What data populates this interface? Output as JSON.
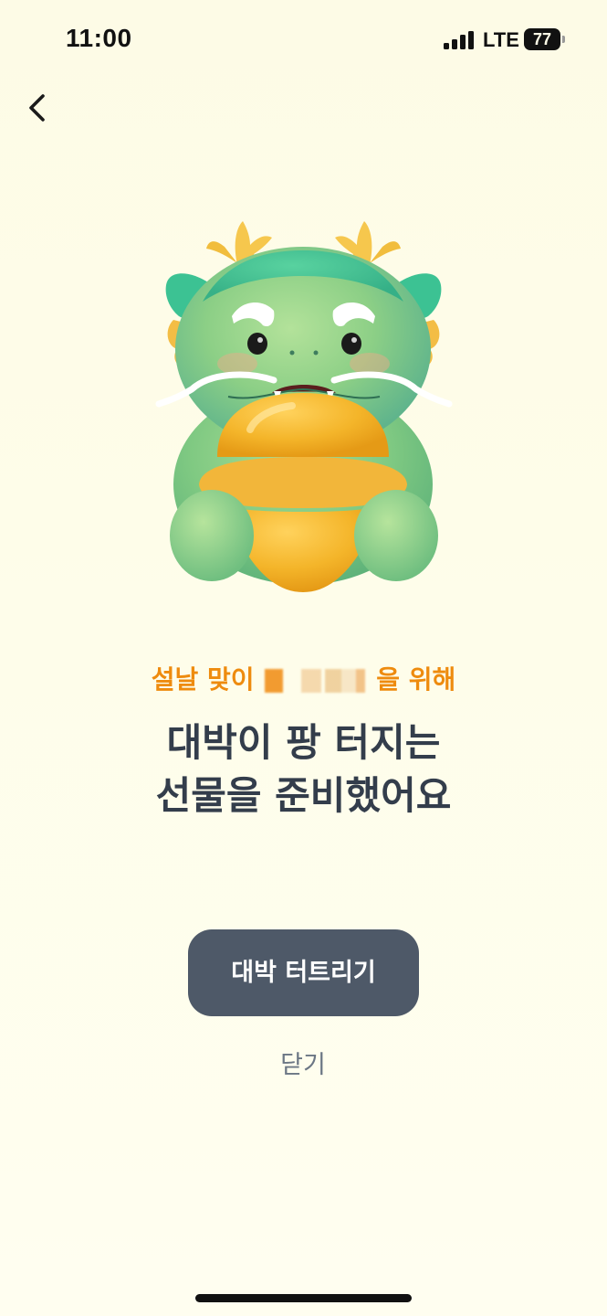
{
  "status_bar": {
    "time": "11:00",
    "network": "LTE",
    "battery": "77",
    "signal_icon": "cellular-signal-icon"
  },
  "nav": {
    "back_icon": "chevron-left-icon"
  },
  "illustration": {
    "subject": "dragon-mascot-holding-gold-ingot"
  },
  "content": {
    "subtitle_prefix": "설날 맞이",
    "subtitle_suffix": "을 위해",
    "title_line1": "대박이 팡 터지는",
    "title_line2": "선물을 준비했어요"
  },
  "actions": {
    "primary_label": "대박 터트리기",
    "close_label": "닫기"
  },
  "colors": {
    "accent_orange": "#ee8b0e",
    "title_text": "#333d4b",
    "button_bg": "#4e5968",
    "background": "#fdfbe6"
  }
}
